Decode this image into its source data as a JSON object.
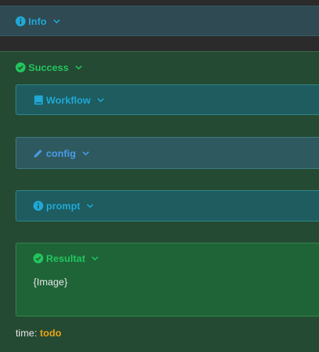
{
  "info": {
    "label": "Info"
  },
  "success": {
    "label": "Success"
  },
  "sections": {
    "workflow": {
      "label": "Workflow"
    },
    "config": {
      "label": "config"
    },
    "prompt": {
      "label": "prompt"
    },
    "result": {
      "label": "Resultat",
      "content": "{Image}"
    }
  },
  "footer": {
    "time_label": "time:",
    "time_value": "todo"
  },
  "colors": {
    "cyan": "#1fa8d6",
    "blue": "#4a9be8",
    "green": "#22c55e",
    "orange": "#e8a317"
  }
}
